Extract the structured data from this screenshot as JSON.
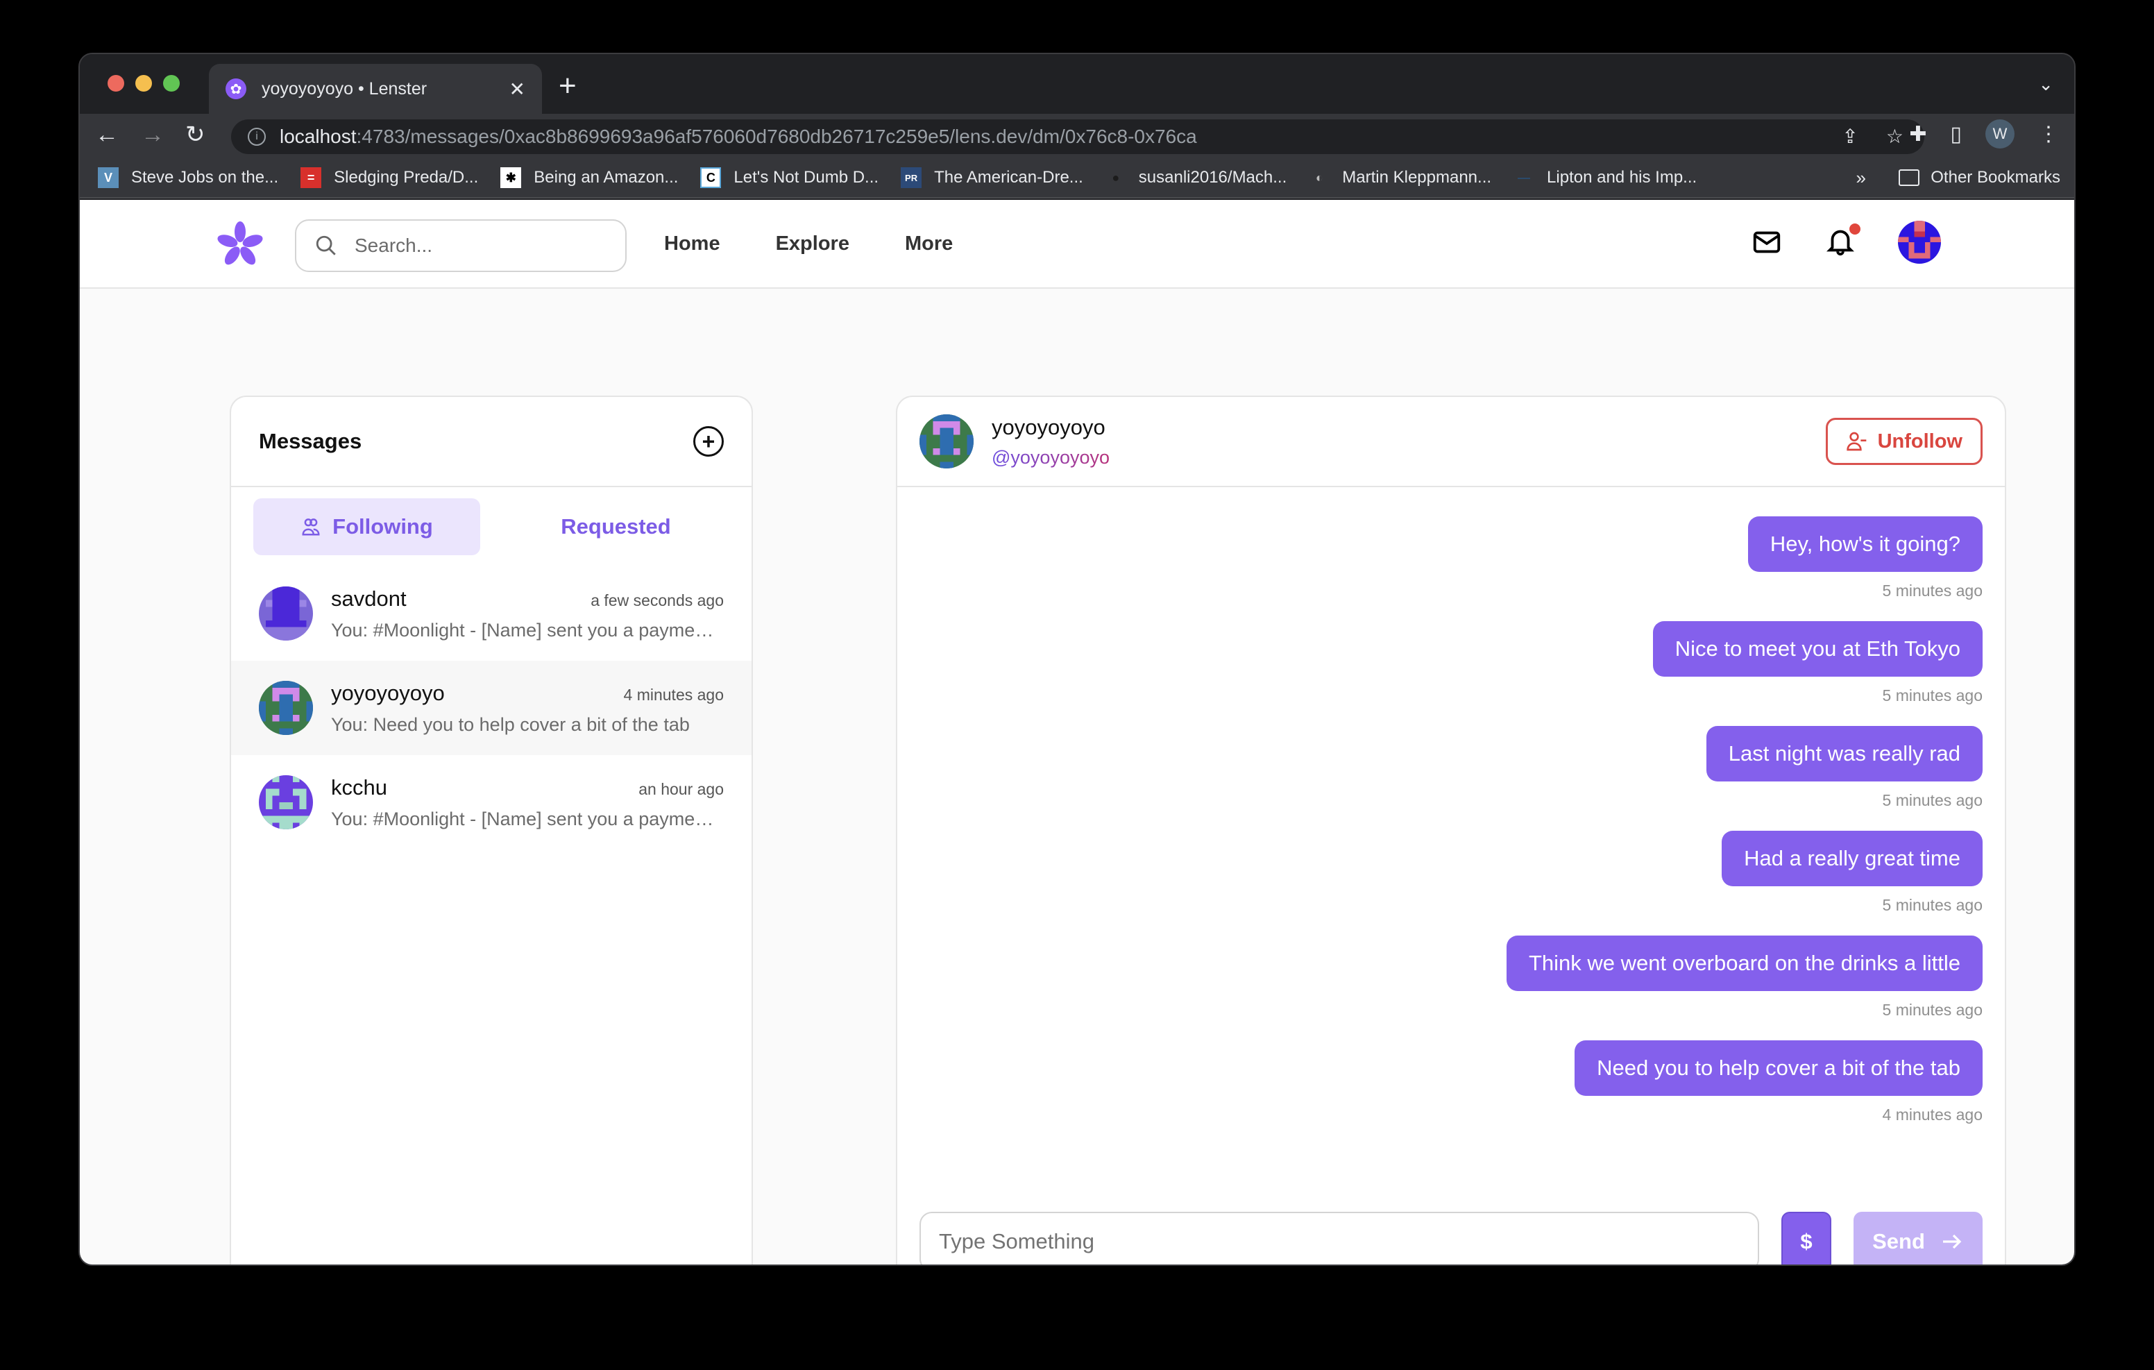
{
  "browser": {
    "tab_title": "yoyoyoyoyo • Lenster",
    "url_host": "localhost",
    "url_path": ":4783/messages/0xac8b8699693a96af576060d7680db26717c259e5/lens.dev/dm/0x76c8-0x76ca",
    "profile_initial": "W",
    "bookmarks": [
      {
        "label": "Steve Jobs on the...",
        "icon": "V"
      },
      {
        "label": "Sledging Preda/D...",
        "icon": "="
      },
      {
        "label": "Being an Amazon...",
        "icon": "✱"
      },
      {
        "label": "Let's Not Dumb D...",
        "icon": "C"
      },
      {
        "label": "The American-Dre...",
        "icon": "PR"
      },
      {
        "label": "susanli2016/Mach...",
        "icon": "●"
      },
      {
        "label": "Martin Kleppmann...",
        "icon": "◐"
      },
      {
        "label": "Lipton and his Imp...",
        "icon": "—"
      }
    ],
    "bookmarks_overflow": "»",
    "other_bookmarks": "Other Bookmarks"
  },
  "app": {
    "brand_color": "#8b5cf6",
    "search_placeholder": "Search...",
    "nav": [
      "Home",
      "Explore",
      "More"
    ],
    "notification_badge": true
  },
  "messages_panel": {
    "title": "Messages",
    "tabs": [
      {
        "label": "Following",
        "active": true
      },
      {
        "label": "Requested",
        "active": false
      }
    ],
    "conversations": [
      {
        "name": "savdont",
        "time": "a few seconds ago",
        "preview": "You: #Moonlight - [Name] sent you a payment request",
        "selected": false
      },
      {
        "name": "yoyoyoyoyo",
        "time": "4 minutes ago",
        "preview": "You: Need you to help cover a bit of the tab",
        "selected": true
      },
      {
        "name": "kcchu",
        "time": "an hour ago",
        "preview": "You: #Moonlight - [Name] sent you a payment request",
        "selected": false
      }
    ]
  },
  "chat": {
    "name": "yoyoyoyoyo",
    "handle": "@yoyoyoyoyo",
    "unfollow_label": "Unfollow",
    "messages": [
      {
        "text": "Hey, how's it going?",
        "time": "5 minutes ago"
      },
      {
        "text": "Nice to meet you at Eth Tokyo",
        "time": "5 minutes ago"
      },
      {
        "text": "Last night was really rad",
        "time": "5 minutes ago"
      },
      {
        "text": "Had a really great time",
        "time": "5 minutes ago"
      },
      {
        "text": "Think we went overboard on the drinks a little",
        "time": "5 minutes ago"
      },
      {
        "text": "Need you to help cover a bit of the tab",
        "time": "4 minutes ago"
      }
    ],
    "composer_placeholder": "Type Something",
    "composer_value": "",
    "payment_label": "$",
    "send_label": "Send"
  }
}
